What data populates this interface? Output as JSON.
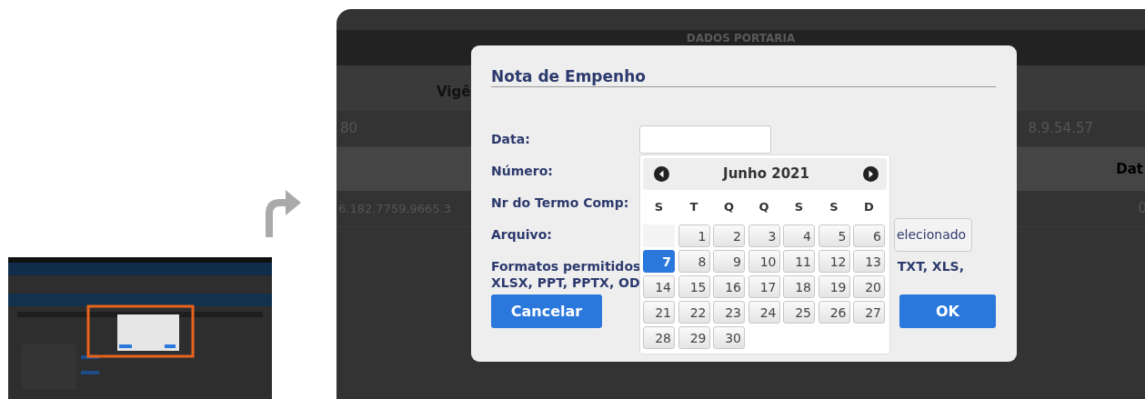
{
  "background": {
    "section_title": "DADOS PORTARIA",
    "header_1": {
      "column_a": "Vigê"
    },
    "data_1": {
      "column_a": "80",
      "column_b": "8.9.54.57"
    },
    "header_2": {
      "column_b": "Dat"
    },
    "data_2": {
      "column_a": "6.182.7759.9665.3",
      "column_b": "0"
    }
  },
  "dialog": {
    "title": "Nota de Empenho",
    "fields": [
      {
        "label": "Data:",
        "kind": "date"
      },
      {
        "label": "Número:",
        "kind": "text"
      },
      {
        "label": "Nr do Termo Comp:",
        "kind": "text"
      },
      {
        "label": "Arquivo:",
        "kind": "file",
        "button": "elecionado"
      }
    ],
    "formats_text": [
      "Formatos permitidos",
      "XLSX, PPT, PPTX, OD"
    ],
    "formats_text_right": "TXT, XLS,",
    "buttons": [
      {
        "label": "Cancelar"
      },
      {
        "label": "OK"
      }
    ],
    "calendar": {
      "month": "Junho 2021",
      "weekdays": [
        "S",
        "T",
        "Q",
        "Q",
        "S",
        "S",
        "D"
      ],
      "weeks": [
        [
          {
            "kind": "blank"
          },
          {
            "label": "1",
            "selected": false
          },
          {
            "label": "2",
            "selected": false
          },
          {
            "label": "3",
            "selected": false
          },
          {
            "label": "4",
            "selected": false
          },
          {
            "label": "5",
            "selected": false
          },
          {
            "label": "6",
            "selected": false
          }
        ],
        [
          {
            "label": "7",
            "selected": true
          },
          {
            "label": "8",
            "selected": false
          },
          {
            "label": "9",
            "selected": false
          },
          {
            "label": "10",
            "selected": false
          },
          {
            "label": "11",
            "selected": false
          },
          {
            "label": "12",
            "selected": false
          },
          {
            "label": "13",
            "selected": false
          }
        ],
        [
          {
            "label": "14",
            "selected": false
          },
          {
            "label": "15",
            "selected": false
          },
          {
            "label": "16",
            "selected": false
          },
          {
            "label": "17",
            "selected": false
          },
          {
            "label": "18",
            "selected": false
          },
          {
            "label": "19",
            "selected": false
          },
          {
            "label": "20",
            "selected": false
          }
        ],
        [
          {
            "label": "21",
            "selected": false
          },
          {
            "label": "22",
            "selected": false
          },
          {
            "label": "23",
            "selected": false
          },
          {
            "label": "24",
            "selected": false
          },
          {
            "label": "25",
            "selected": false
          },
          {
            "label": "26",
            "selected": false
          },
          {
            "label": "27",
            "selected": false
          }
        ],
        [
          {
            "label": "28",
            "selected": false
          },
          {
            "label": "29",
            "selected": false
          },
          {
            "label": "30",
            "selected": false
          }
        ]
      ]
    }
  }
}
